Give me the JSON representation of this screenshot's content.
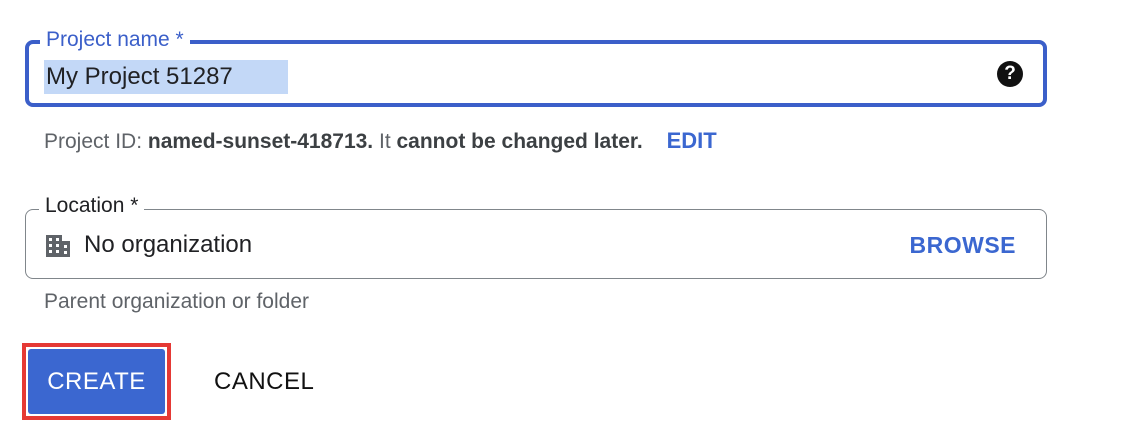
{
  "project_name_field": {
    "label": "Project name *",
    "value": "My Project 51287",
    "help_icon": "help-circle-icon"
  },
  "project_id": {
    "prefix": "Project ID: ",
    "id": "named-sunset-418713.",
    "middle": " It ",
    "emphasis": "cannot be changed later.",
    "edit_label": "EDIT"
  },
  "location_field": {
    "label": "Location *",
    "icon": "building-icon",
    "value": "No organization",
    "browse_label": "BROWSE",
    "helper": "Parent organization or folder"
  },
  "actions": {
    "create_label": "CREATE",
    "cancel_label": "CANCEL"
  },
  "colors": {
    "accent": "#3b67d0",
    "focus_border": "#3b5fc9",
    "highlight_outline": "#e53935",
    "selection": "#c3d8f7"
  }
}
